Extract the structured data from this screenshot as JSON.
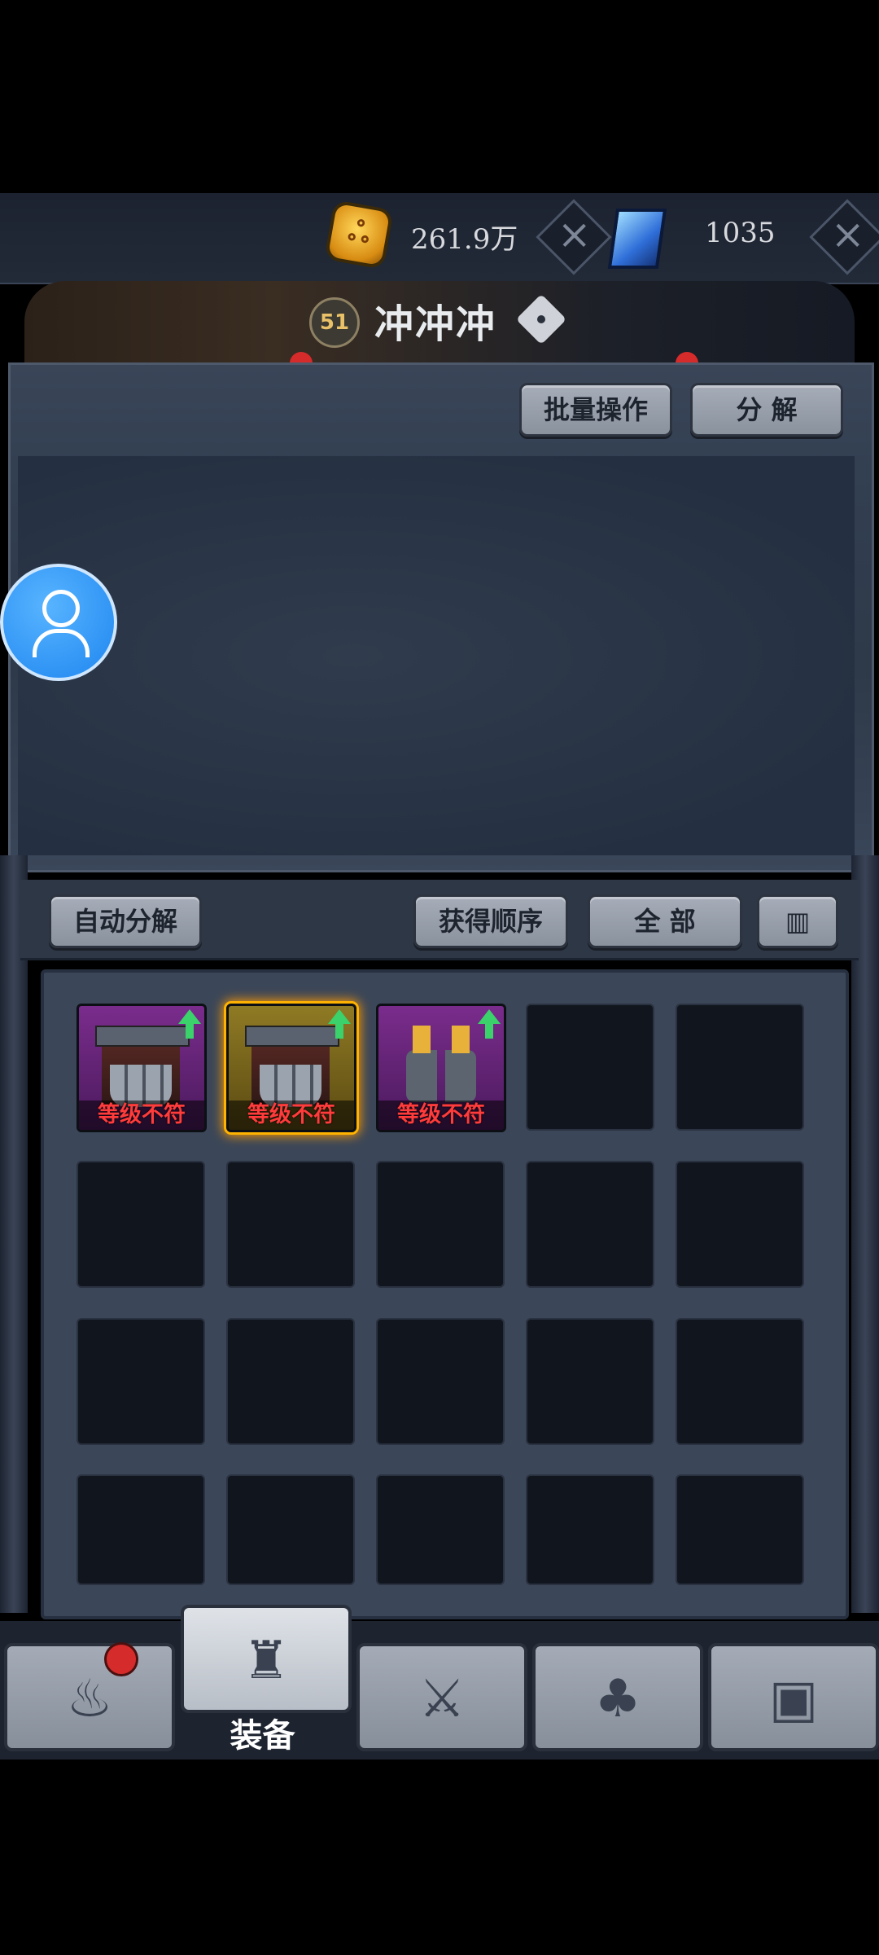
{
  "currency": {
    "gold_amount": "261.9万",
    "gem_amount": "1035",
    "gold_icon_glyph": "ஃ"
  },
  "player": {
    "level": "51",
    "name": "冲冲冲"
  },
  "panel": {
    "batch_button": "批量操作",
    "decompose_button": "分 解"
  },
  "bag_bar": {
    "auto_decompose": "自动分解",
    "sort_order": "获得顺序",
    "filter_all": "全 部",
    "trash_icon": "trash-icon"
  },
  "items": [
    {
      "type": "leg-armor",
      "rarity": "purple",
      "status": "等级不符"
    },
    {
      "type": "leg-armor",
      "rarity": "gold",
      "status": "等级不符"
    },
    {
      "type": "boots",
      "rarity": "purple",
      "status": "等级不符"
    }
  ],
  "nav": {
    "active_label": "装备",
    "icons": [
      "campfire-icon",
      "helmet-icon",
      "crossed-swords-icon",
      "forest-icon",
      "chest-icon"
    ]
  },
  "colors": {
    "purple_rarity": "#7a2c8c",
    "gold_rarity": "#8f7a24",
    "warning_text": "#ff3b3b",
    "upgrade_arrow": "#3bd16b",
    "notification_dot": "#d52b2b"
  }
}
